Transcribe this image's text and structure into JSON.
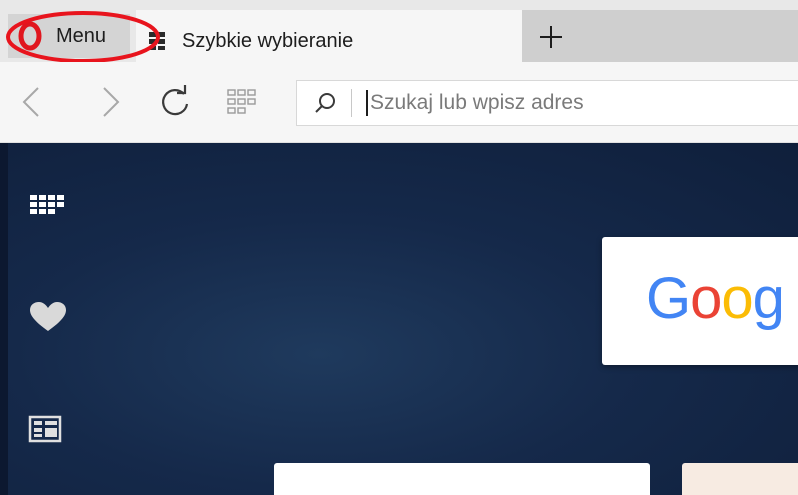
{
  "tabbar": {
    "menu_label": "Menu",
    "active_tab_title": "Szybkie wybieranie"
  },
  "toolbar": {
    "address_placeholder": "Szukaj lub wpisz adres"
  },
  "speed_dial": {
    "google_tile_text": [
      "G",
      "o",
      "o",
      "g"
    ]
  },
  "colors": {
    "opera_red": "#e0161e",
    "highlight_red": "#e8141d",
    "google_blue": "#4285f4",
    "google_red": "#ea4335",
    "google_yellow": "#fbbc05",
    "page_background": "#15294a"
  },
  "icons": {
    "menu": "opera-logo-icon",
    "tab": "speed-dial-grid-icon",
    "new_tab": "plus-icon",
    "back": "chevron-left-icon",
    "forward": "chevron-right-icon",
    "reload": "reload-icon",
    "speed_dial": "grid-icon",
    "search": "search-icon",
    "sidebar": [
      "speed-dial-icon",
      "heart-icon",
      "news-icon"
    ]
  }
}
